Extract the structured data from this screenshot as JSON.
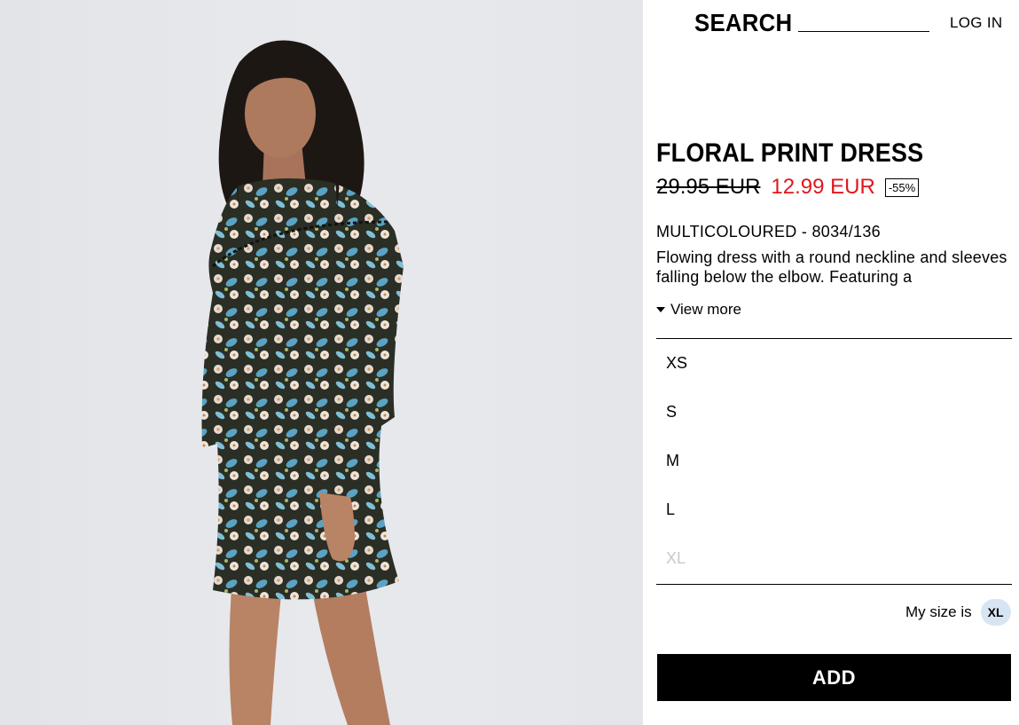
{
  "header": {
    "search_label": "SEARCH",
    "login_label": "LOG IN"
  },
  "product": {
    "title": "FLORAL PRINT DRESS",
    "old_price": "29.95 EUR",
    "new_price": "12.99 EUR",
    "discount": "-55%",
    "color_ref": "MULTICOLOURED - 8034/136",
    "description": "Flowing dress with a round neckline and sleeves falling below the elbow. Featuring a",
    "view_more_label": "View more",
    "image_name": "model wearing floral print dress"
  },
  "sizes": [
    {
      "label": "XS",
      "available": true
    },
    {
      "label": "S",
      "available": true
    },
    {
      "label": "M",
      "available": true
    },
    {
      "label": "L",
      "available": true
    },
    {
      "label": "XL",
      "available": false
    }
  ],
  "my_size": {
    "label": "My size is",
    "value": "XL"
  },
  "add_button_label": "ADD",
  "colors": {
    "sale_red": "#e0171c",
    "my_size_badge": "#d7e5f3",
    "unavailable_gray": "#c8c8c8",
    "image_background": "#e4e6ea"
  }
}
